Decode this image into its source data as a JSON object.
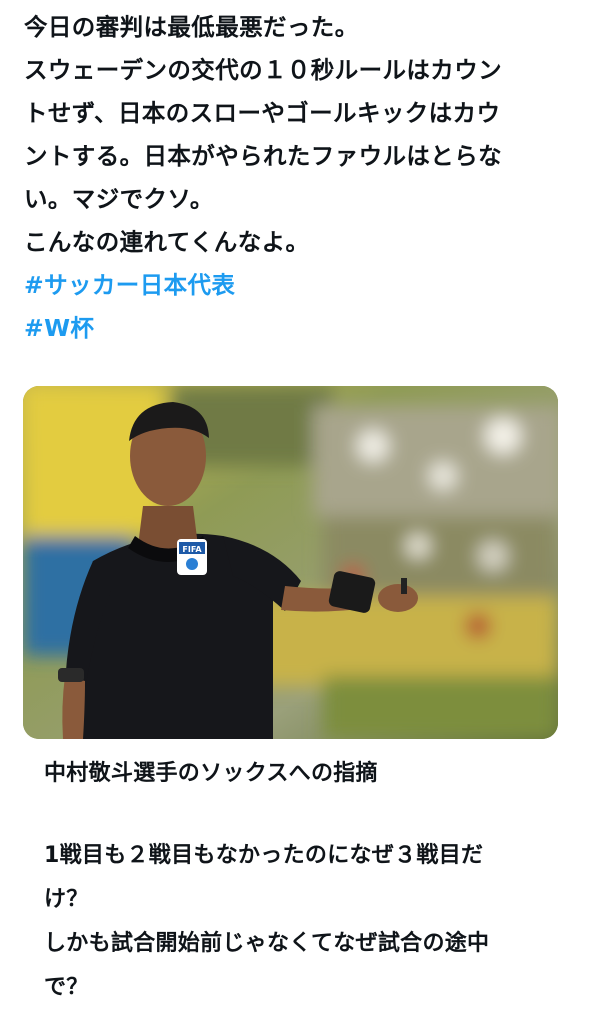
{
  "tweet": {
    "lines": [
      "今日の審判は最低最悪だった。",
      "スウェーデンの交代の１０秒ルールはカウン",
      "トせず、日本のスローやゴールキックはカウ",
      "ントする。日本がやられたファウルはとらな",
      "い。マジでクソ。",
      "こんなの連れてくんなよ。"
    ],
    "hashtags": [
      "#サッカー日本代表",
      "#W杯"
    ]
  },
  "media": {
    "description_icon": "referee-photo",
    "badge_text": "FIFA",
    "colors": {
      "jersey": "#15161a",
      "skin": "#8a5a3b",
      "background_green": "#7d8a3a",
      "background_yellow": "#d9c33a"
    }
  },
  "quote": {
    "title": "中村敬斗選手のソックスへの指摘",
    "body_lines": [
      "1戦目も２戦目もなかったのになぜ３戦目だ",
      "け？",
      "しかも試合開始前じゃなくてなぜ試合の途中",
      "で？"
    ]
  },
  "colors": {
    "text": "#0f1419",
    "link": "#1d9bf0",
    "background": "#ffffff"
  }
}
